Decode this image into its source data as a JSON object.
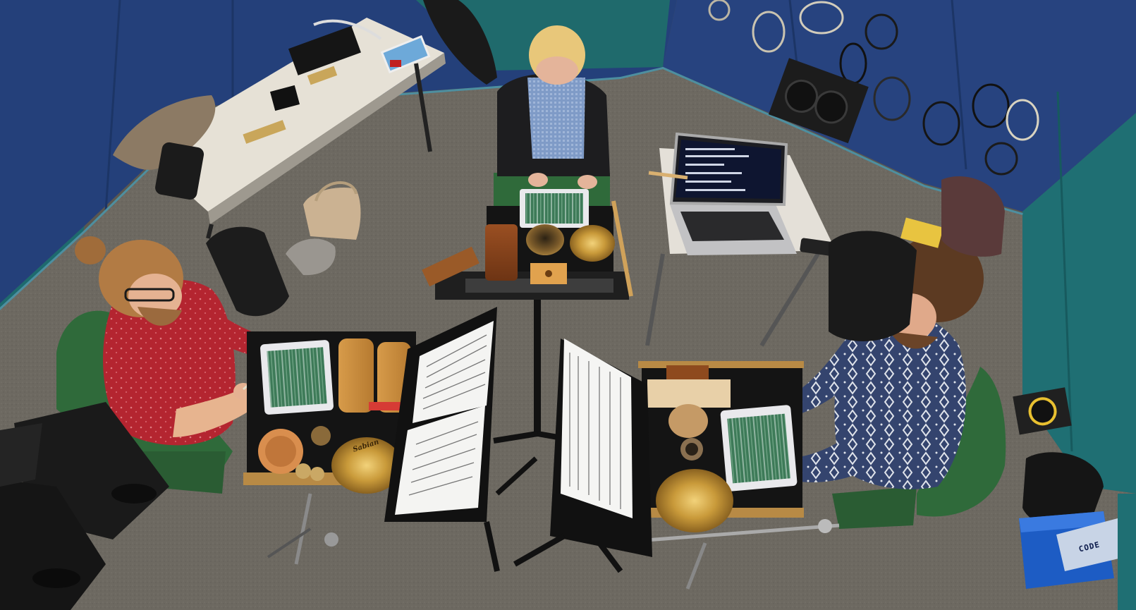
{
  "scene": {
    "description_type": "overhead photo",
    "palette": {
      "carpet": "#6e6a62",
      "wall_blue": "#24407a",
      "wall_teal": "#1f6f73",
      "chair_green": "#2f6a3a",
      "shirt_red": "#b5232b",
      "sweater_navy": "#34446e",
      "wood": "#c88a3e",
      "ipad_screen": "#3c7a5a",
      "case_blue": "#1d5cc4"
    }
  },
  "labels": {
    "case_label": "CODE",
    "cymbal_label": "Sabian"
  }
}
